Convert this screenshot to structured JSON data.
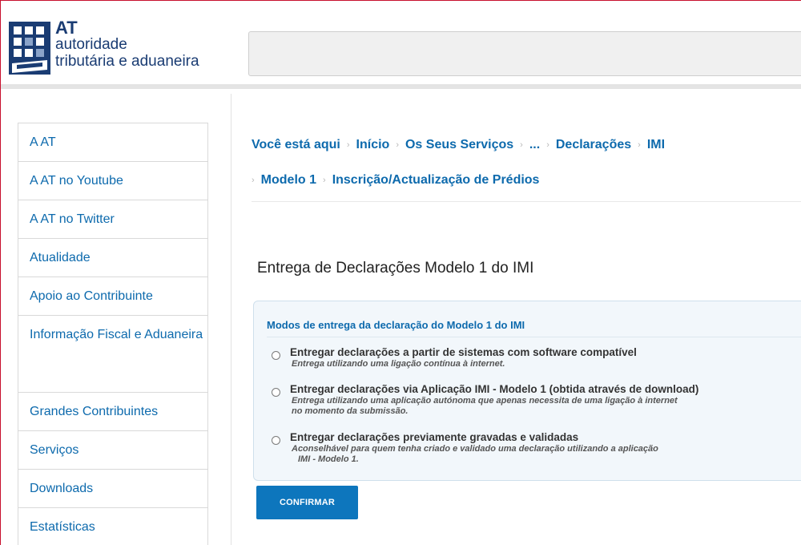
{
  "header": {
    "logo_at": "AT",
    "logo_line1": "autoridade",
    "logo_line2": "tributária e aduaneira",
    "brand_color": "#1a3c73"
  },
  "sidebar": {
    "items": [
      {
        "label": "A AT"
      },
      {
        "label": "A AT no Youtube"
      },
      {
        "label": "A AT no Twitter"
      },
      {
        "label": "Atualidade"
      },
      {
        "label": "Apoio ao Contribuinte"
      },
      {
        "label": "Informação Fiscal e Aduaneira"
      },
      {
        "label": "Grandes Contribuintes"
      },
      {
        "label": "Serviços"
      },
      {
        "label": "Downloads"
      },
      {
        "label": "Estatísticas"
      }
    ],
    "link_color": "#0d6aad"
  },
  "breadcrumb": {
    "row1": [
      "Você está aqui",
      "Início",
      "Os Seus Serviços",
      "...",
      "Declarações",
      "IMI"
    ],
    "row2": [
      "Modelo 1",
      "Inscrição/Actualização de Prédios"
    ],
    "separator": "›"
  },
  "main": {
    "title": "Entrega de Declarações Modelo 1 do IMI",
    "panel": {
      "title": "Modos de entrega da declaração do Modelo 1 do IMI",
      "options": [
        {
          "label": "Entregar declarações a partir de sistemas com software compatível",
          "desc1": "Entrega utilizando uma ligação contínua à internet.",
          "desc2": ""
        },
        {
          "label": "Entregar declarações via Aplicação IMI - Modelo 1 (obtida através de download)",
          "desc1": "Entrega utilizando uma aplicação autónoma que apenas necessita de uma ligação à internet",
          "desc2": "no momento da submissão."
        },
        {
          "label": "Entregar declarações previamente gravadas e validadas",
          "desc1": "Aconselhável para quem tenha criado e validado uma declaração utilizando a aplicação",
          "desc2": "IMI - Modelo 1."
        }
      ]
    },
    "confirm_label": "CONFIRMAR",
    "button_color": "#0d76bd"
  }
}
